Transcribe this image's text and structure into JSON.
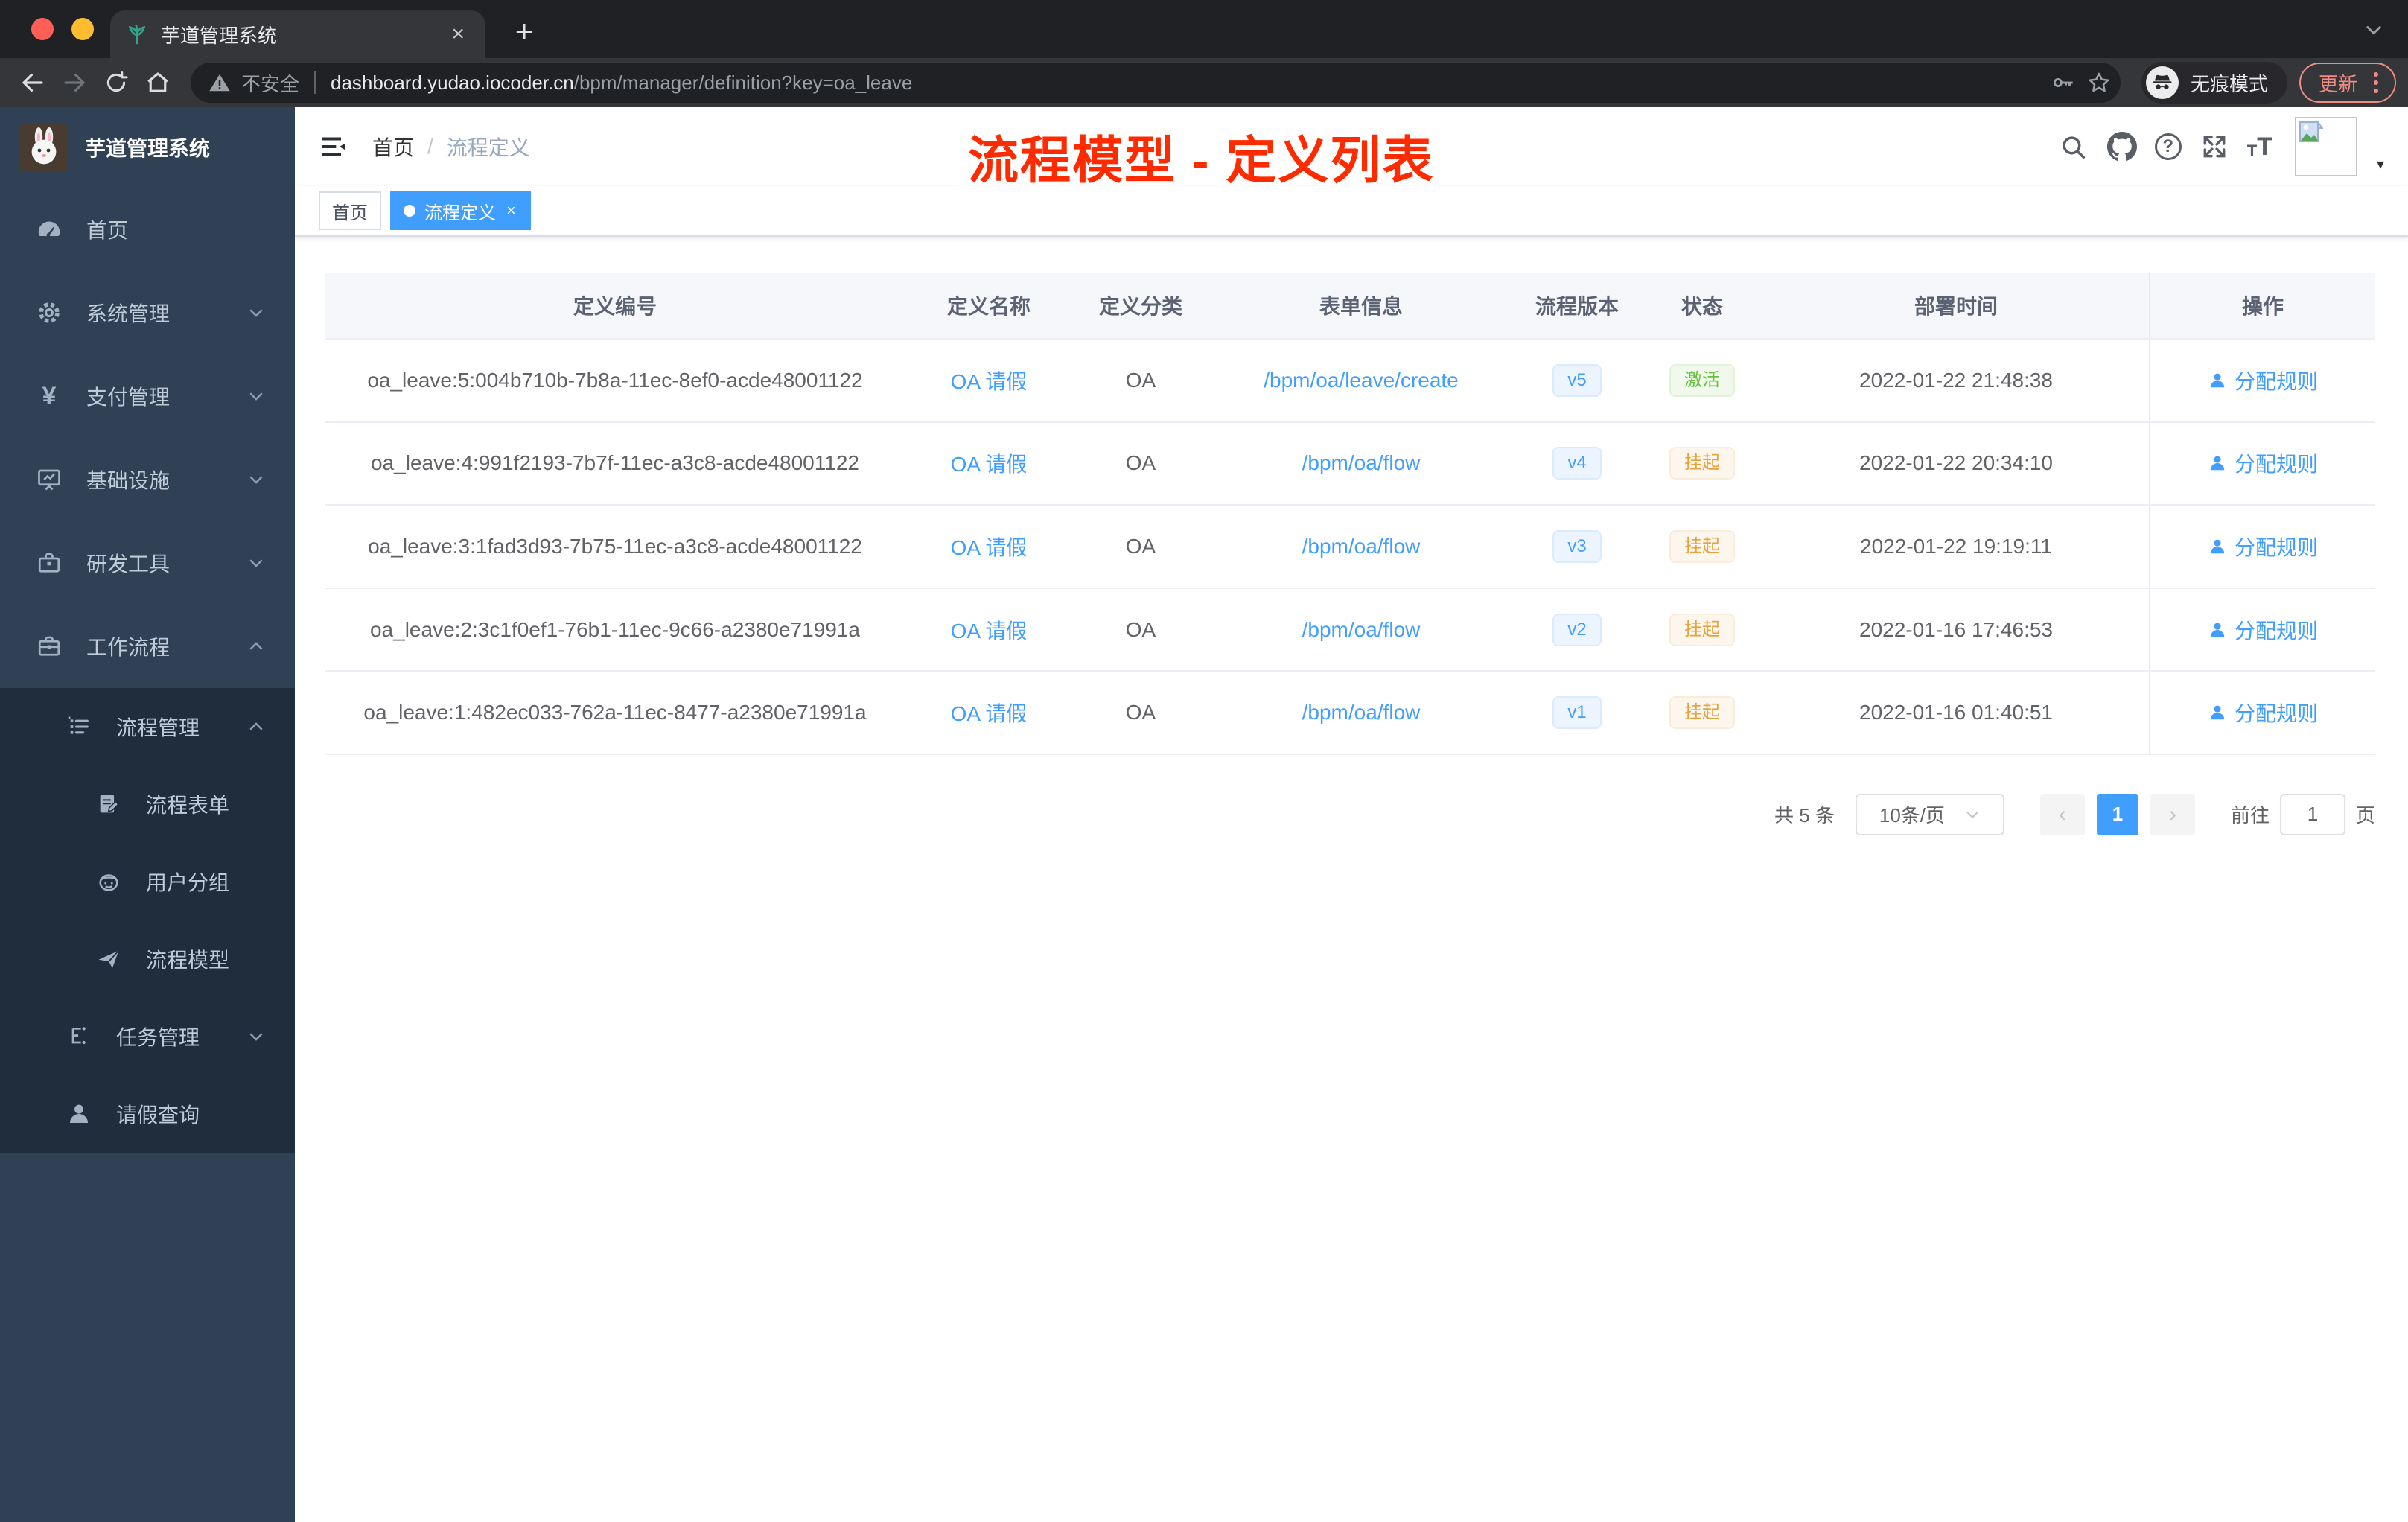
{
  "browser": {
    "tab_title": "芋道管理系统",
    "security_label": "不安全",
    "url_host": "dashboard.yudao.iocoder.cn",
    "url_path": "/bpm/manager/definition?key=oa_leave",
    "incognito_label": "无痕模式",
    "update_label": "更新"
  },
  "icons": {
    "new_tab": "+",
    "tab_close": "×",
    "tag_close": "×",
    "help": "?",
    "caret_down": "▾",
    "font_size_small": "T",
    "font_size_large": "T",
    "yen": "¥",
    "prev": "‹",
    "next": "›"
  },
  "sidebar": {
    "logo_title": "芋道管理系统",
    "items": [
      {
        "label": "首页",
        "icon": "dashboard-icon"
      },
      {
        "label": "系统管理",
        "icon": "gear-icon",
        "arrow": "down"
      },
      {
        "label": "支付管理",
        "icon": "yen-icon",
        "arrow": "down"
      },
      {
        "label": "基础设施",
        "icon": "monitor-icon",
        "arrow": "down"
      },
      {
        "label": "研发工具",
        "icon": "toolbox-icon",
        "arrow": "down"
      },
      {
        "label": "工作流程",
        "icon": "briefcase-icon",
        "arrow": "up"
      }
    ],
    "workflow_menu": {
      "process_management": {
        "label": "流程管理",
        "arrow": "up",
        "children": [
          {
            "label": "流程表单",
            "icon": "form-icon"
          },
          {
            "label": "用户分组",
            "icon": "robot-icon"
          },
          {
            "label": "流程模型",
            "icon": "paper-plane-icon"
          }
        ]
      },
      "task_management": {
        "label": "任务管理",
        "arrow": "down"
      },
      "leave_query": {
        "label": "请假查询"
      }
    }
  },
  "header": {
    "breadcrumb_home": "首页",
    "breadcrumb_sep": "/",
    "breadcrumb_current": "流程定义",
    "annotation": "流程模型 - 定义列表"
  },
  "tags": [
    {
      "label": "首页",
      "active": false
    },
    {
      "label": "流程定义",
      "active": true
    }
  ],
  "table": {
    "columns": [
      "定义编号",
      "定义名称",
      "定义分类",
      "表单信息",
      "流程版本",
      "状态",
      "部署时间",
      "操作"
    ],
    "rows": [
      {
        "id": "oa_leave:5:004b710b-7b8a-11ec-8ef0-acde48001122",
        "name": "OA 请假",
        "category": "OA",
        "form": "/bpm/oa/leave/create",
        "version": "v5",
        "status": "激活",
        "deployed_at": "2022-01-22 21:48:38",
        "action": "分配规则"
      },
      {
        "id": "oa_leave:4:991f2193-7b7f-11ec-a3c8-acde48001122",
        "name": "OA 请假",
        "category": "OA",
        "form": "/bpm/oa/flow",
        "version": "v4",
        "status": "挂起",
        "deployed_at": "2022-01-22 20:34:10",
        "action": "分配规则"
      },
      {
        "id": "oa_leave:3:1fad3d93-7b75-11ec-a3c8-acde48001122",
        "name": "OA 请假",
        "category": "OA",
        "form": "/bpm/oa/flow",
        "version": "v3",
        "status": "挂起",
        "deployed_at": "2022-01-22 19:19:11",
        "action": "分配规则"
      },
      {
        "id": "oa_leave:2:3c1f0ef1-76b1-11ec-9c66-a2380e71991a",
        "name": "OA 请假",
        "category": "OA",
        "form": "/bpm/oa/flow",
        "version": "v2",
        "status": "挂起",
        "deployed_at": "2022-01-16 17:46:53",
        "action": "分配规则"
      },
      {
        "id": "oa_leave:1:482ec033-762a-11ec-8477-a2380e71991a",
        "name": "OA 请假",
        "category": "OA",
        "form": "/bpm/oa/flow",
        "version": "v1",
        "status": "挂起",
        "deployed_at": "2022-01-16 01:40:51",
        "action": "分配规则"
      }
    ]
  },
  "pagination": {
    "total": "共 5 条",
    "page_size": "10条/页",
    "current_page": "1",
    "goto_label": "前往",
    "goto_value": "1",
    "page_unit": "页"
  },
  "colors": {
    "accent": "#409eff",
    "annotation_red": "#ff2b00",
    "status_active": "#67c23a",
    "status_suspended": "#e6a23c",
    "sidebar_bg": "#304156",
    "submenu_bg": "#1f2d3d",
    "update_salmon": "#f28b82",
    "traffic_red": "#ff5f57",
    "traffic_yellow": "#febc2e",
    "traffic_green": "#28c840"
  }
}
